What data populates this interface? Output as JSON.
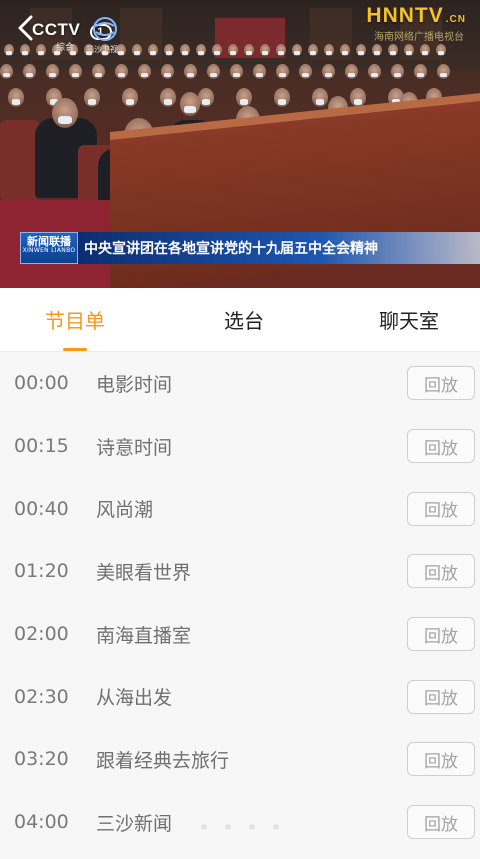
{
  "video": {
    "channel_logo": "CCTV",
    "channel_number": "1",
    "channel_sub": "综合",
    "globe_label": "三沙卫视",
    "station_logo": "HNNTV",
    "station_logo_suffix": ".CN",
    "station_sub": "海南网络广播电视台",
    "news_logo_main": "新闻联播",
    "news_logo_sub": "XINWEN LIANBO",
    "news_headline": "中央宣讲团在各地宣讲党的十九届五中全会精神"
  },
  "tabs": [
    {
      "label": "节目单",
      "active": true
    },
    {
      "label": "选台",
      "active": false
    },
    {
      "label": "聊天室",
      "active": false
    }
  ],
  "programs": [
    {
      "time": "00:00",
      "title": "电影时间",
      "action": "回放"
    },
    {
      "time": "00:15",
      "title": "诗意时间",
      "action": "回放"
    },
    {
      "time": "00:40",
      "title": "风尚潮",
      "action": "回放"
    },
    {
      "time": "01:20",
      "title": "美眼看世界",
      "action": "回放"
    },
    {
      "time": "02:00",
      "title": "南海直播室",
      "action": "回放"
    },
    {
      "time": "02:30",
      "title": "从海出发",
      "action": "回放"
    },
    {
      "time": "03:20",
      "title": "跟着经典去旅行",
      "action": "回放"
    },
    {
      "time": "04:00",
      "title": "三沙新闻",
      "action": "回放"
    }
  ],
  "colors": {
    "accent": "#f39a1c",
    "news_blue": "#1d56b0",
    "station_gold": "#f2c230"
  }
}
